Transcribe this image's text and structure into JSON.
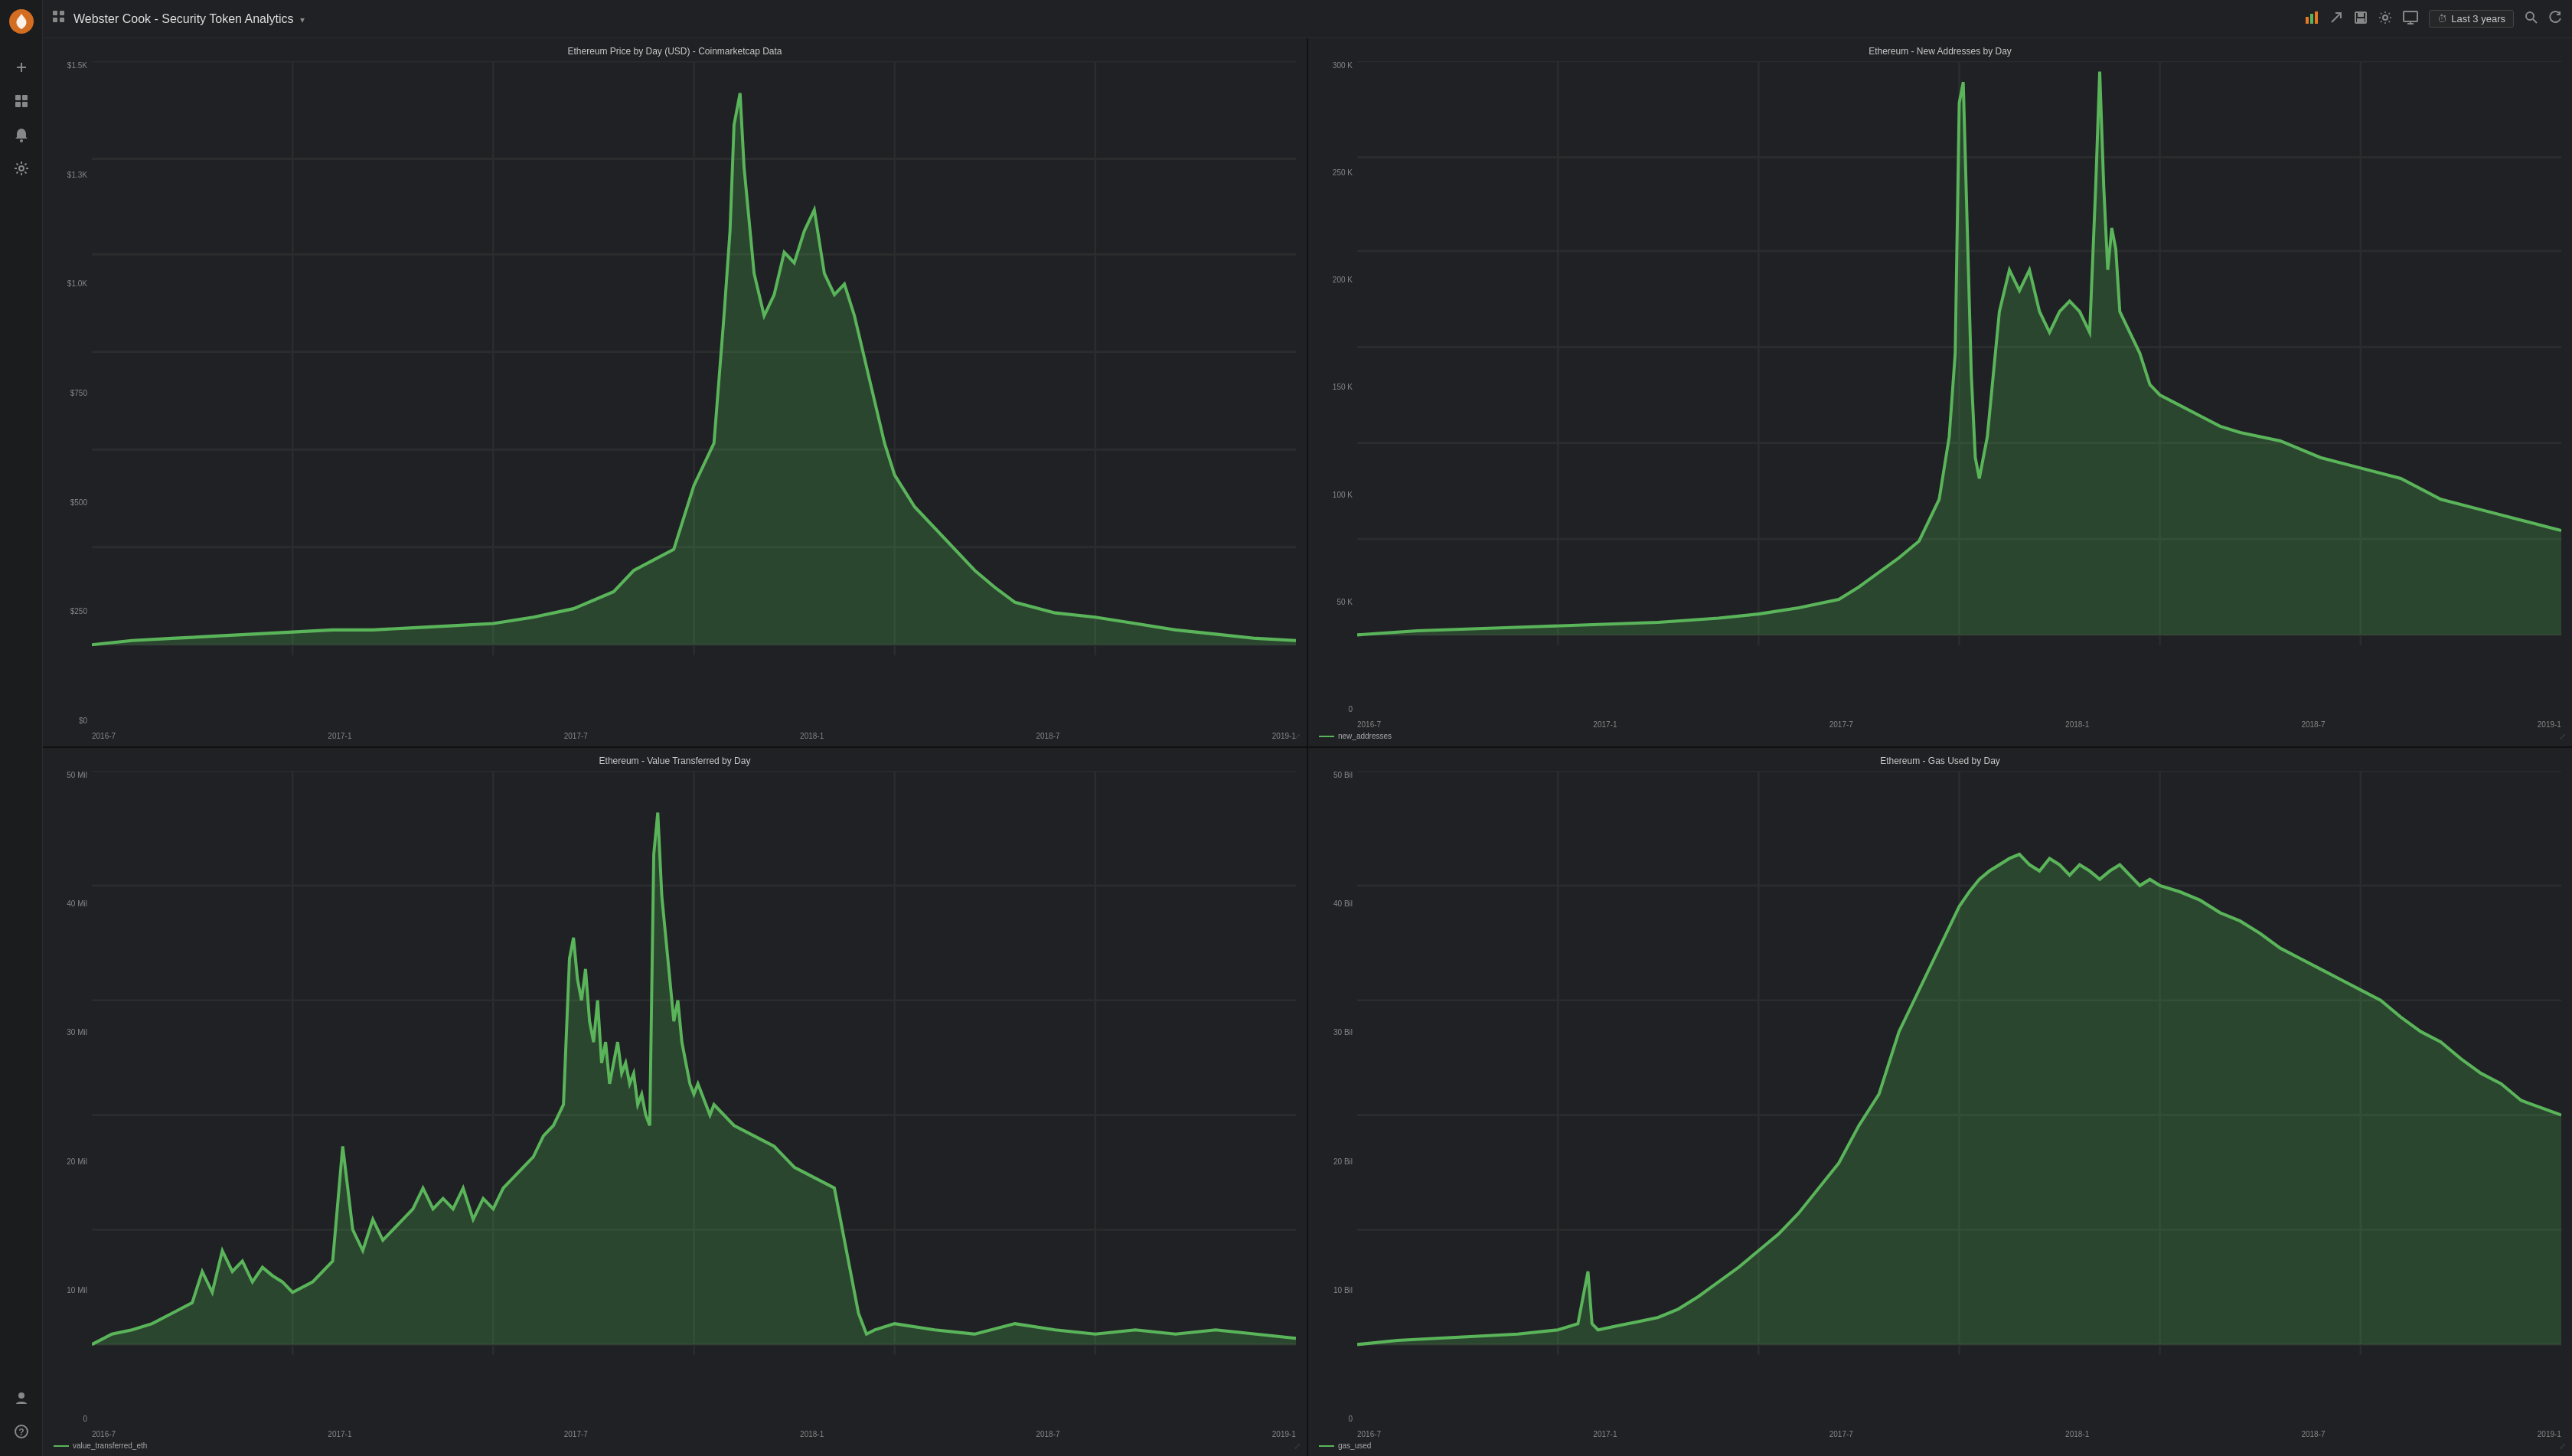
{
  "app": {
    "logo_icon": "🔥",
    "title": "Webster Cook - Security Token Analytics",
    "title_arrow": "▾"
  },
  "sidebar": {
    "items": [
      {
        "id": "add",
        "icon": "+",
        "label": "Add panel"
      },
      {
        "id": "dashboard",
        "icon": "⊞",
        "label": "Dashboard"
      },
      {
        "id": "alerts",
        "icon": "🔔",
        "label": "Alerts"
      },
      {
        "id": "settings",
        "icon": "⚙",
        "label": "Settings"
      }
    ],
    "bottom_items": [
      {
        "id": "user",
        "icon": "👤",
        "label": "User"
      },
      {
        "id": "help",
        "icon": "?",
        "label": "Help"
      }
    ]
  },
  "topbar": {
    "actions": [
      {
        "id": "chart-icon",
        "icon": "📊"
      },
      {
        "id": "share-icon",
        "icon": "↗"
      },
      {
        "id": "save-icon",
        "icon": "💾"
      },
      {
        "id": "settings-icon",
        "icon": "⚙"
      },
      {
        "id": "display-icon",
        "icon": "🖥"
      }
    ],
    "time_filter": "Last 3 years",
    "search_icon": "🔍",
    "refresh_icon": "↺"
  },
  "charts": [
    {
      "id": "eth-price",
      "title": "Ethereum Price by Day (USD) - Coinmarketcap Data",
      "y_labels": [
        "$1.5K",
        "$1.3K",
        "$1.0K",
        "$750",
        "$500",
        "$250",
        "$0"
      ],
      "x_labels": [
        "2016-7",
        "2017-1",
        "2017-7",
        "2018-1",
        "2018-7",
        "2019-1"
      ],
      "legend": null,
      "position": "top-left"
    },
    {
      "id": "eth-addresses",
      "title": "Ethereum - New Addresses by Day",
      "y_labels": [
        "300 K",
        "250 K",
        "200 K",
        "150 K",
        "100 K",
        "50 K",
        "0"
      ],
      "x_labels": [
        "2016-7",
        "2017-1",
        "2017-7",
        "2018-1",
        "2018-7",
        "2019-1"
      ],
      "legend": "new_addresses",
      "position": "top-right"
    },
    {
      "id": "eth-value",
      "title": "Ethereum - Value Transferred by Day",
      "y_labels": [
        "50 Mil",
        "40 Mil",
        "30 Mil",
        "20 Mil",
        "10 Mil",
        "0"
      ],
      "x_labels": [
        "2016-7",
        "2017-1",
        "2017-7",
        "2018-1",
        "2018-7",
        "2019-1"
      ],
      "legend": "value_transferred_eth",
      "position": "bottom-left"
    },
    {
      "id": "eth-gas",
      "title": "Ethereum - Gas Used by Day",
      "y_labels": [
        "50 Bil",
        "40 Bil",
        "30 Bil",
        "20 Bil",
        "10 Bil",
        "0"
      ],
      "x_labels": [
        "2016-7",
        "2017-1",
        "2017-7",
        "2018-1",
        "2018-7",
        "2019-1"
      ],
      "legend": "gas_used",
      "position": "bottom-right"
    }
  ]
}
